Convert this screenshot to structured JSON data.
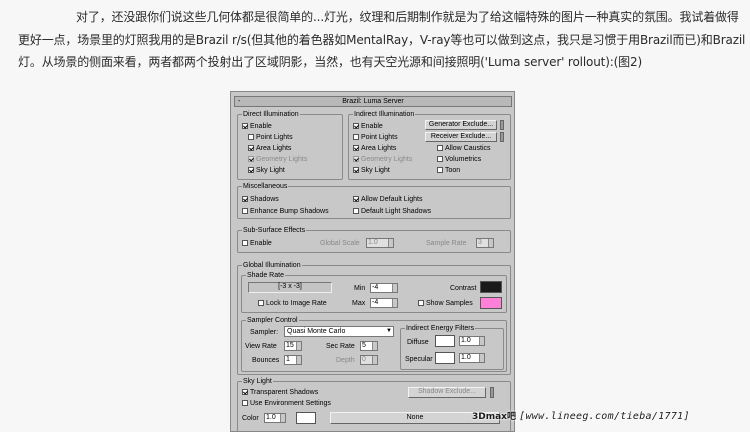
{
  "article": {
    "text": "对了，还没跟你们说这些几何体都是很简单的...灯光，纹理和后期制作就是为了给这幅特殊的图片一种真实的氛围。我试着做得更好一点，场景里的灯照我用的是Brazil r/s(但其他的着色器如MentalRay，V-ray等也可以做到这点，我只是习惯于用Brazil而已)和Brazil 灯。从场景的侧面来看，两者都两个投射出了区域阴影，当然，也有天空光源和间接照明('Luma server' rollout):(图2)"
  },
  "panel": {
    "title": "Brazil: Luma Server",
    "collapse_symbol": "-",
    "direct": {
      "title": "Direct Illumination",
      "enable": "Enable",
      "point_lights": "Point Lights",
      "area_lights": "Area Lights",
      "geometry_lights": "Geometry Lights",
      "sky_light": "Sky Light"
    },
    "indirect": {
      "title": "Indirect Illumination",
      "enable": "Enable",
      "point_lights": "Point Lights",
      "area_lights": "Area Lights",
      "geometry_lights": "Geometry Lights",
      "sky_light": "Sky Light",
      "generator_exclude": "Generator Exclude...",
      "receiver_exclude": "Receiver Exclude...",
      "allow_caustics": "Allow Caustics",
      "volumetrics": "Volumetrics",
      "toon": "Toon"
    },
    "misc": {
      "title": "Miscellaneous",
      "shadows": "Shadows",
      "enhance_bump_shadows": "Enhance Bump Shadows",
      "allow_default_lights": "Allow Default Lights",
      "default_light_shadows": "Default Light Shadows"
    },
    "sss": {
      "title": "Sub-Surface Effects",
      "enable": "Enable",
      "global_scale_label": "Global Scale",
      "global_scale_value": "1.0",
      "sample_rate_label": "Sample Rate",
      "sample_rate_value": "3"
    },
    "gi": {
      "title": "Global Illumination",
      "shade_rate_title": "Shade Rate",
      "shade_rate_readout": "[-3 x -3]",
      "min_label": "Min",
      "min_value": "-4",
      "max_label": "Max",
      "max_value": "-4",
      "contrast_label": "Contrast",
      "lock_to_image_rate": "Lock to Image Rate",
      "show_samples": "Show Samples",
      "sampler_control_title": "Sampler Control",
      "sampler_label": "Sampler:",
      "sampler_value": "Quasi Monte Carlo",
      "view_rate_label": "View Rate",
      "view_rate_value": "15",
      "sec_rate_label": "Sec Rate",
      "sec_rate_value": "5",
      "bounces_label": "Bounces",
      "bounces_value": "1",
      "depth_label": "Depth",
      "depth_value": "0",
      "energy_title": "Indirect Energy Filters",
      "diffuse_label": "Diffuse",
      "diffuse_value": "1.0",
      "specular_label": "Specular",
      "specular_value": "1.0"
    },
    "sky": {
      "title": "Sky Light",
      "transparent_shadows": "Transparent Shadows",
      "use_environment_settings": "Use Environment Settings",
      "shadow_exclude": "Shadow Exclude...",
      "color_label": "Color",
      "color_value": "1.0",
      "map_label": "None"
    }
  },
  "colors": {
    "contrast_swatch": "#1a1a1a",
    "show_samples_swatch": "#ff80d8"
  },
  "watermark": {
    "brand": "3Dmax吧",
    "url": "[www.lineeg.com/tieba/1771]"
  }
}
